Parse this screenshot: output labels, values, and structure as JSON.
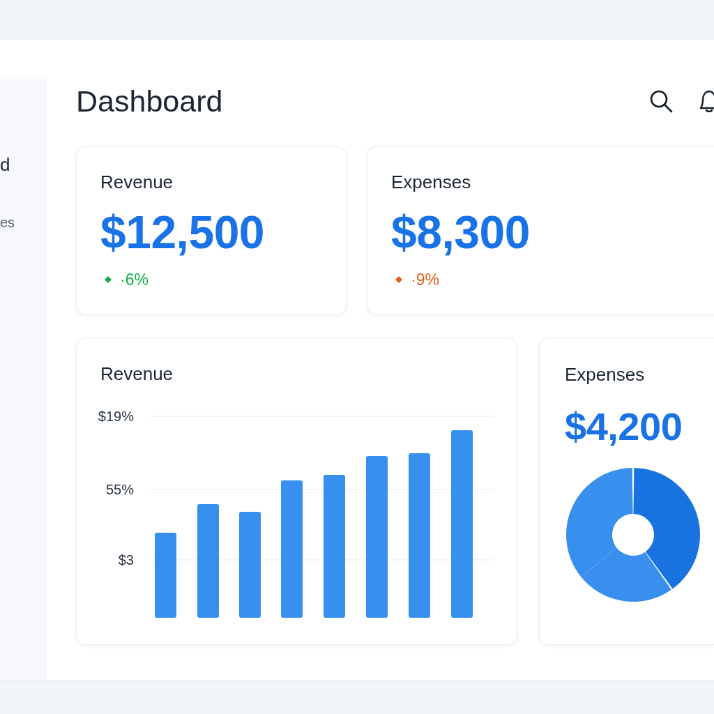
{
  "sidebar": {
    "items": [
      {
        "label": "d",
        "selected": true
      },
      {
        "label": "es",
        "selected": false
      }
    ]
  },
  "header": {
    "title": "Dashboard"
  },
  "stat_cards": [
    {
      "title": "Revenue",
      "value": "$12,500",
      "change": "·6%",
      "positive": true
    },
    {
      "title": "Expenses",
      "value": "$8,300",
      "change": "·9%",
      "positive": false
    }
  ],
  "revenue_chart": {
    "title": "Revenue",
    "y_labels": [
      "$19%",
      "55%",
      "$3"
    ]
  },
  "expenses_card": {
    "title": "Expenses",
    "value": "$4,200"
  }
}
